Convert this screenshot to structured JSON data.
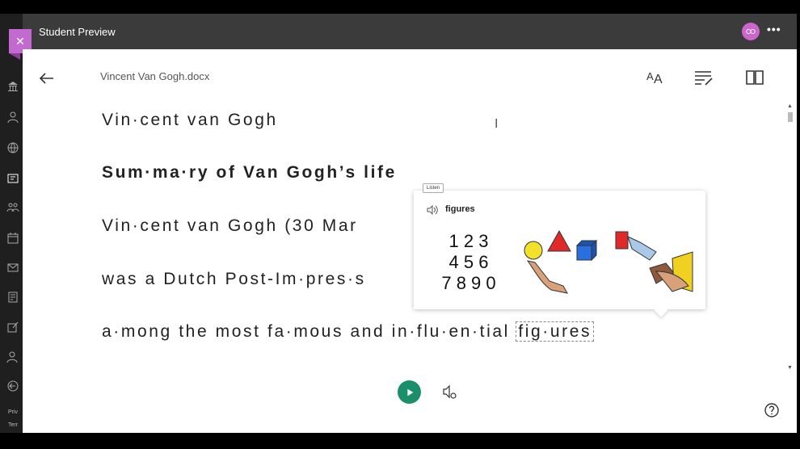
{
  "app": {
    "preview_label": "Student Preview",
    "close_symbol": "✕",
    "more_symbol": "•••"
  },
  "document": {
    "title": "Vincent Van Gogh.docx",
    "lines": [
      "Vin·cent van Gogh",
      "Sum·ma·ry of Van Gogh’s life",
      "Vin·cent van Gogh (30 Mar",
      "was a Dutch Post-Im·pres·s",
      "a·mong the most fa·mous and in·flu·en·tial "
    ],
    "selected_word": "fig·ures"
  },
  "popup": {
    "tooltip": "Listen",
    "word": "figures",
    "numbers": [
      "1 2 3",
      "4 5 6",
      "7 8 9 0"
    ]
  },
  "sidebar_footer": {
    "line1": "Priv",
    "line2": "Terr"
  },
  "icons": {
    "back": "arrow-left-icon",
    "text_size": "text-preferences-icon",
    "grammar": "grammar-options-icon",
    "reading": "reading-preferences-icon",
    "play": "play-icon",
    "voice": "voice-settings-icon",
    "help": "help-icon"
  },
  "colors": {
    "accent_purple": "#c36ad1",
    "play_green": "#1b8f6a",
    "topbar": "#3b3b3b"
  }
}
